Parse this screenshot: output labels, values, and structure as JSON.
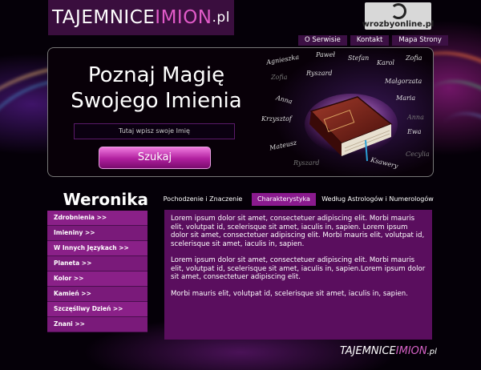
{
  "logo": {
    "part1": "TAJEMNICE",
    "part2": "IMION",
    "part3": ".pl"
  },
  "partner": {
    "label": "wrozbyonline.pl"
  },
  "topnav": {
    "items": [
      "O Serwisie",
      "Kontakt",
      "Mapa Strony"
    ]
  },
  "hero": {
    "title_line1": "Poznaj Magię",
    "title_line2": "Swojego Imienia",
    "search_placeholder": "Tutaj wpisz swoje Imię",
    "search_button": "Szukaj",
    "names": [
      "Agnieszka",
      "Paweł",
      "Stefan",
      "Zofia",
      "Karol",
      "Zofia",
      "Ryszard",
      "Małgorzata",
      "Anna",
      "Maria",
      "Krzysztof",
      "Anna",
      "Ewa",
      "Mateusz",
      "Cecylia",
      "Ryszard",
      "Ksawery"
    ]
  },
  "heading": "Weronika",
  "tabs": [
    "Pochodzenie i Znaczenie",
    "Charakterystyka",
    "Według Astrologów i Numerologów"
  ],
  "active_tab": "Charakterystyka",
  "sidebar": {
    "items": [
      "Zdrobnienia >>",
      "Imieniny >>",
      "W Innych Językach >>",
      "Planeta >>",
      "Kolor >>",
      "Kamień >>",
      "Szczęśliwy Dzień >>",
      "Znani >>"
    ]
  },
  "content": {
    "paragraphs": [
      "Lorem ipsum dolor sit amet, consectetuer adipiscing elit. Morbi mauris elit, volutpat id, scelerisque sit amet, iaculis in, sapien. Lorem ipsum dolor sit amet, consectetuer adipiscing elit. Morbi mauris elit, volutpat id, scelerisque sit amet, iaculis in, sapien.",
      "Lorem ipsum dolor sit amet, consectetuer adipiscing elit. Morbi mauris elit, volutpat id, scelerisque sit amet, iaculis in, sapien.Lorem ipsum dolor sit amet, consectetuer adipiscing elit.",
      "Morbi mauris elit, volutpat id, scelerisque sit amet, iaculis in, sapien."
    ]
  },
  "footer": {
    "part1": "TAJEMNICE",
    "part2": "IMION",
    "part3": ".pl"
  },
  "colors": {
    "brand_purple": "#3a0e3e",
    "accent_pink": "#e05ac8",
    "content_bg": "#5a0e5e"
  }
}
